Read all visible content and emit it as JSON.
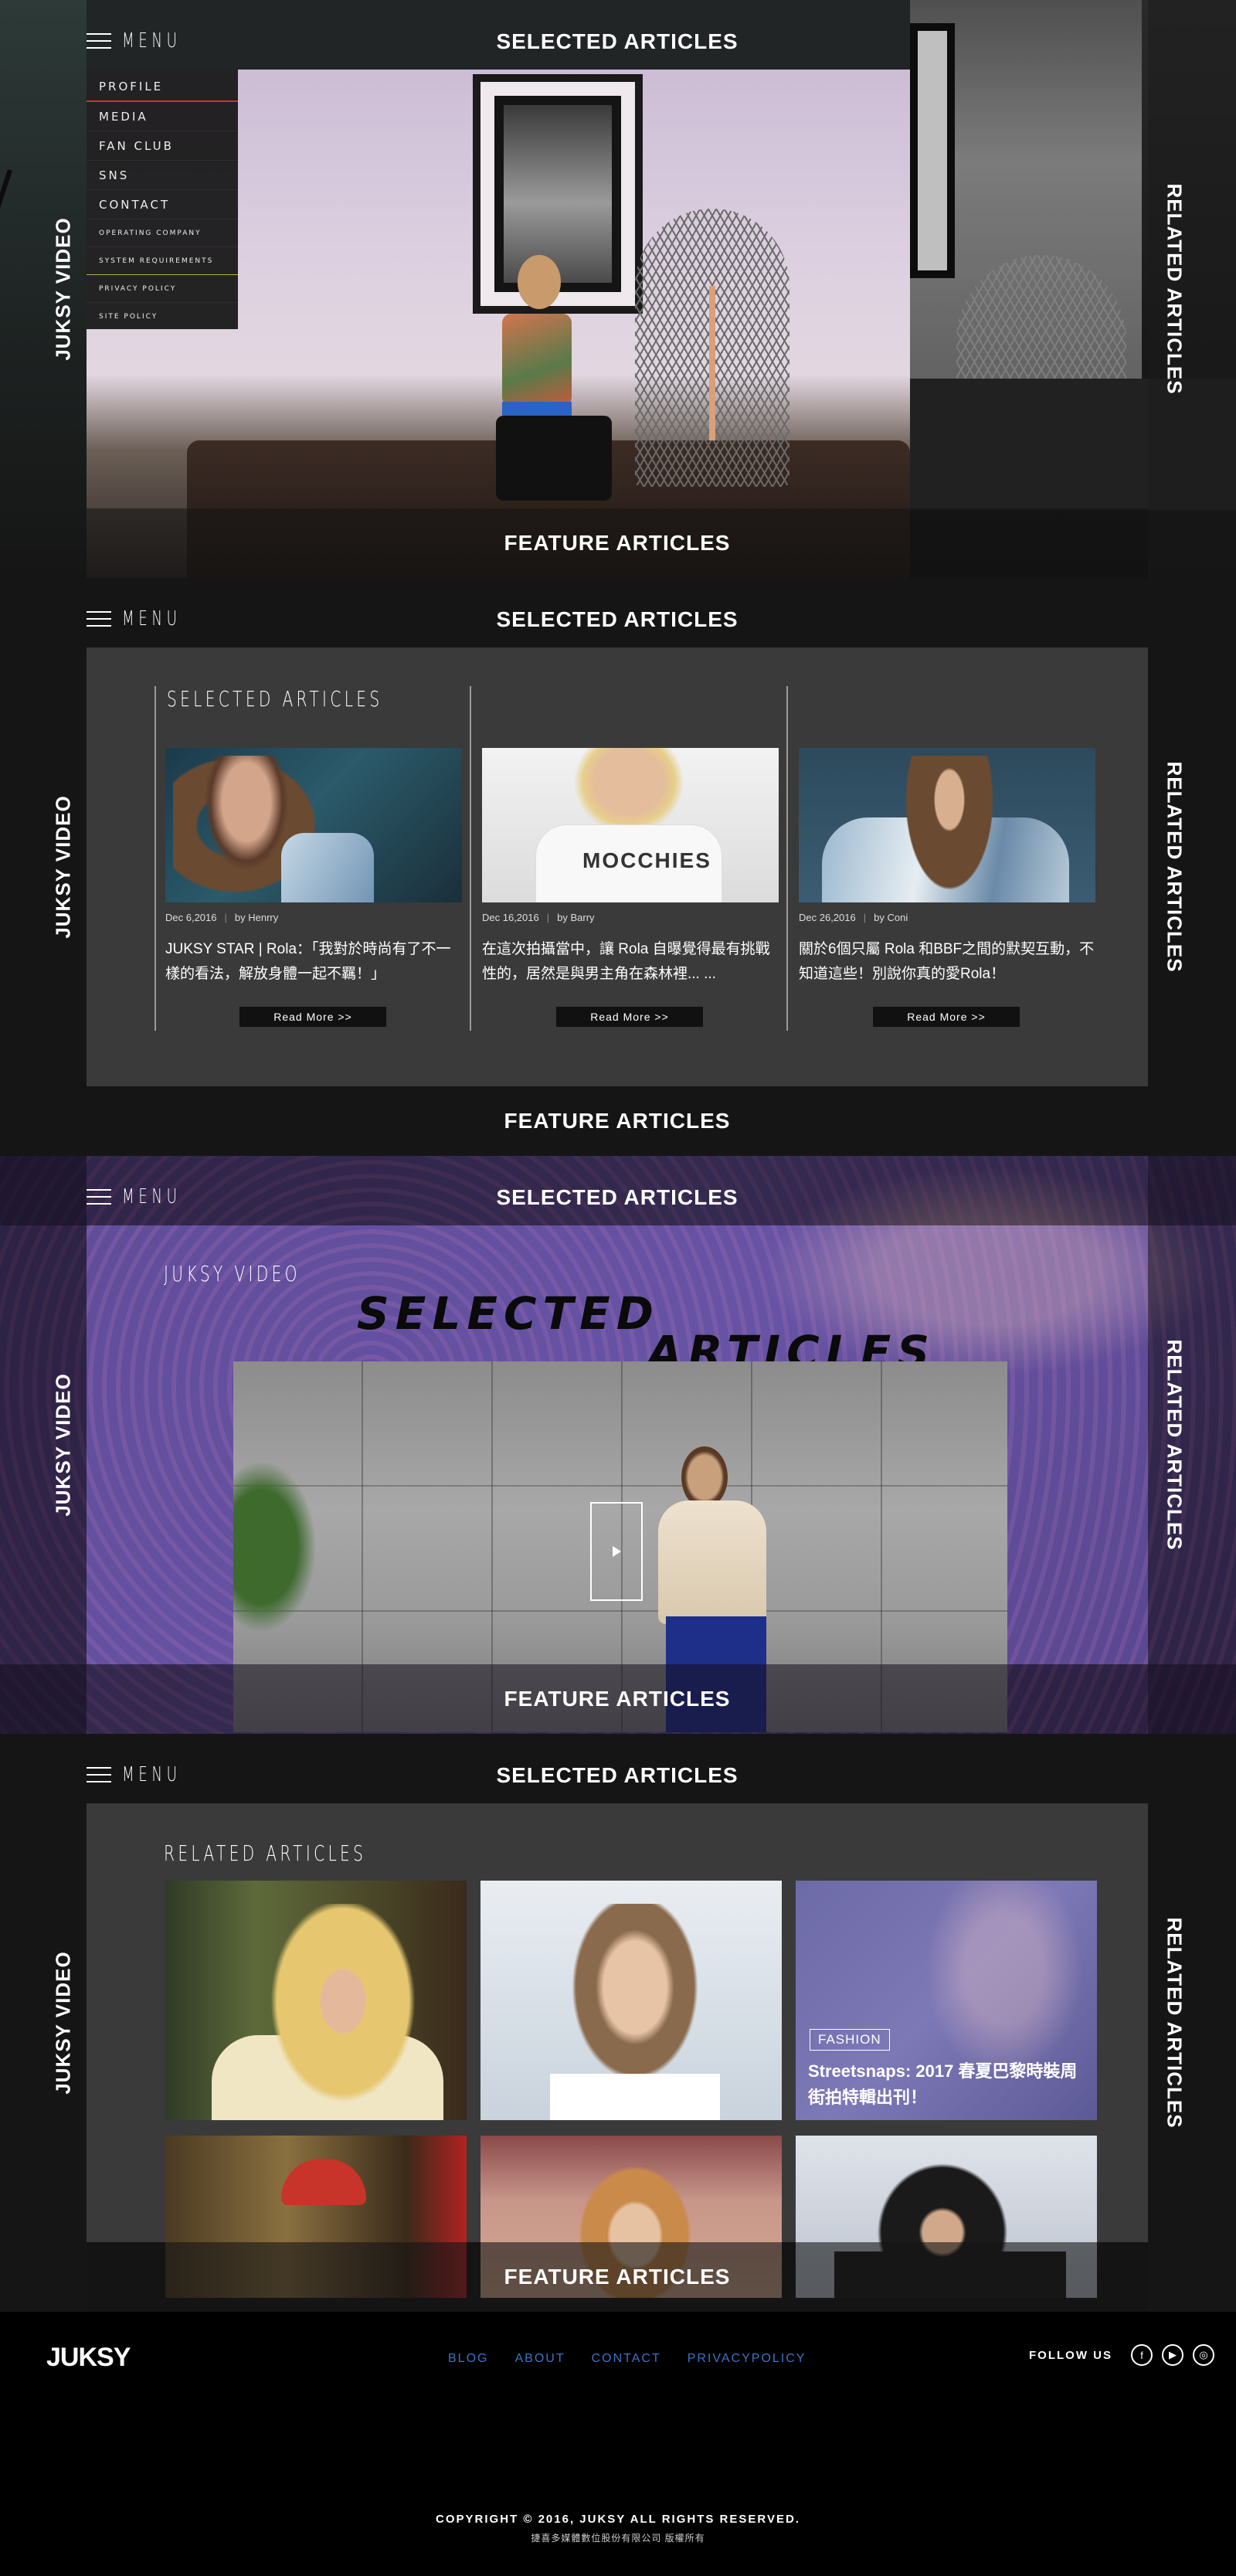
{
  "nav": {
    "menu_label": "MENU",
    "top": "SELECTED ARTICLES",
    "bottom": "FEATURE ARTICLES",
    "left": "JUKSY VIDEO",
    "right": "RELATED ARTICLES"
  },
  "dropdown": {
    "items": [
      "PROFILE",
      "MEDIA",
      "FAN CLUB",
      "SNS",
      "CONTACT"
    ],
    "small_items": [
      "OPERATING COMPANY",
      "SYSTEM REQUIREMENTS",
      "PRIVACY POLICY",
      "SITE POLICY"
    ]
  },
  "selected": {
    "title": "SELECTED ARTICLES",
    "cards": [
      {
        "date": "Dec 6,2016",
        "author": "by Henrry",
        "title": "JUKSY STAR | Rola：「我對於時尚有了不一樣的看法，解放身體一起不羈！」",
        "read_more": "Read More >>"
      },
      {
        "date": "Dec 16,2016",
        "author": "by Barry",
        "title": "在這次拍攝當中，讓 Rola 自曝覺得最有挑戰性的，居然是與男主角在森林裡... ...",
        "read_more": "Read More >>"
      },
      {
        "date": "Dec 26,2016",
        "author": "by Coni",
        "title": "關於6個只屬 Rola 和BBF之間的默契互動，不知道這些！別說你真的愛Rola！",
        "read_more": "Read More >>"
      }
    ],
    "shirt_text": "MOCCHIES"
  },
  "video": {
    "label": "JUKSY VIDEO",
    "big_line1": "SELECTED",
    "big_line2": "ARTICLES"
  },
  "related": {
    "title": "RELATED ARTICLES",
    "tag": "FASHION",
    "tile_title": "Streetsnaps: 2017 春夏巴黎時裝周街拍特輯出刊！"
  },
  "footer": {
    "logo": "JUKSY",
    "links": [
      "BLOG",
      "ABOUT",
      "CONTACT",
      "PRIVACYPOLICY"
    ],
    "follow": "FOLLOW US",
    "social": [
      "facebook-icon",
      "youtube-icon",
      "instagram-icon"
    ],
    "copyright": "COPYRIGHT © 2016, JUKSY ALL RIGHTS RESERVED.",
    "company": "捷喜多媒體數位股份有限公司 版權所有"
  },
  "colors": {
    "footer_link": "#3b74c7",
    "active_menu": "#c0392b",
    "panel": "#3a3a3a"
  }
}
